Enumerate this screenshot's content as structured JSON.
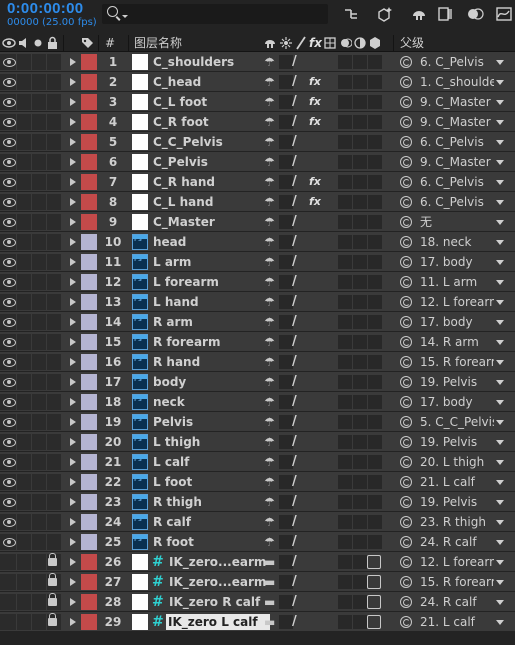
{
  "timecode": "0:00:00:00",
  "fps_readout": "00000 (25.00 fps)",
  "header": {
    "hash": "#",
    "source_name": "图层名称",
    "parent": "父级"
  },
  "layers": [
    {
      "num": "1",
      "name": "C_shoulders",
      "color": "#c44a4a",
      "src": "solid",
      "fx": false,
      "parent": "6. C_Pelvis"
    },
    {
      "num": "2",
      "name": "C_head",
      "color": "#c44a4a",
      "src": "solid",
      "fx": true,
      "parent": "1. C_shoulde"
    },
    {
      "num": "3",
      "name": "C_L foot",
      "color": "#c44a4a",
      "src": "solid",
      "fx": true,
      "parent": "9. C_Master"
    },
    {
      "num": "4",
      "name": "C_R foot",
      "color": "#c44a4a",
      "src": "solid",
      "fx": true,
      "parent": "9. C_Master"
    },
    {
      "num": "5",
      "name": "C_C_Pelvis",
      "color": "#c44a4a",
      "src": "solid",
      "fx": false,
      "parent": "6. C_Pelvis"
    },
    {
      "num": "6",
      "name": "C_Pelvis",
      "color": "#c44a4a",
      "src": "solid",
      "fx": false,
      "parent": "9. C_Master"
    },
    {
      "num": "7",
      "name": "C_R hand",
      "color": "#c44a4a",
      "src": "solid",
      "fx": true,
      "parent": "6. C_Pelvis"
    },
    {
      "num": "8",
      "name": "C_L hand",
      "color": "#c44a4a",
      "src": "solid",
      "fx": true,
      "parent": "6. C_Pelvis"
    },
    {
      "num": "9",
      "name": "C_Master",
      "color": "#c44a4a",
      "src": "solid",
      "fx": false,
      "parent": "无"
    },
    {
      "num": "10",
      "name": "head",
      "color": "#b4b4d2",
      "src": "ps",
      "fx": false,
      "parent": "18. neck"
    },
    {
      "num": "11",
      "name": "L arm",
      "color": "#b4b4d2",
      "src": "ps",
      "fx": false,
      "parent": "17. body"
    },
    {
      "num": "12",
      "name": "L forearm",
      "color": "#b4b4d2",
      "src": "ps",
      "fx": false,
      "parent": "11. L arm"
    },
    {
      "num": "13",
      "name": "L hand",
      "color": "#b4b4d2",
      "src": "ps",
      "fx": false,
      "parent": "12. L forearm"
    },
    {
      "num": "14",
      "name": "R arm",
      "color": "#b4b4d2",
      "src": "ps",
      "fx": false,
      "parent": "17. body"
    },
    {
      "num": "15",
      "name": "R forearm",
      "color": "#b4b4d2",
      "src": "ps",
      "fx": false,
      "parent": "14. R arm"
    },
    {
      "num": "16",
      "name": "R hand",
      "color": "#b4b4d2",
      "src": "ps",
      "fx": false,
      "parent": "15. R forearm"
    },
    {
      "num": "17",
      "name": "body",
      "color": "#b4b4d2",
      "src": "ps",
      "fx": false,
      "parent": "19. Pelvis"
    },
    {
      "num": "18",
      "name": "neck",
      "color": "#b4b4d2",
      "src": "ps",
      "fx": false,
      "parent": "17. body"
    },
    {
      "num": "19",
      "name": "Pelvis",
      "color": "#b4b4d2",
      "src": "ps",
      "fx": false,
      "parent": "5. C_C_Pelvis"
    },
    {
      "num": "20",
      "name": "L thigh",
      "color": "#b4b4d2",
      "src": "ps",
      "fx": false,
      "parent": "19. Pelvis"
    },
    {
      "num": "21",
      "name": "L calf",
      "color": "#b4b4d2",
      "src": "ps",
      "fx": false,
      "parent": "20. L thigh"
    },
    {
      "num": "22",
      "name": "L foot",
      "color": "#b4b4d2",
      "src": "ps",
      "fx": false,
      "parent": "21. L calf"
    },
    {
      "num": "23",
      "name": "R thigh",
      "color": "#b4b4d2",
      "src": "ps",
      "fx": false,
      "parent": "19. Pelvis"
    },
    {
      "num": "24",
      "name": "R calf",
      "color": "#b4b4d2",
      "src": "ps",
      "fx": false,
      "parent": "23. R thigh"
    },
    {
      "num": "25",
      "name": "R foot",
      "color": "#b4b4d2",
      "src": "ps",
      "fx": false,
      "parent": "24. R calf"
    },
    {
      "num": "26",
      "name": "IK_zero...earm",
      "color": "#c44a4a",
      "src": "null",
      "fx": false,
      "parent": "12. L forearm"
    },
    {
      "num": "27",
      "name": "IK_zero...earm",
      "color": "#c44a4a",
      "src": "null",
      "fx": false,
      "parent": "15. R forearm"
    },
    {
      "num": "28",
      "name": "IK_zero R calf",
      "color": "#c44a4a",
      "src": "null",
      "fx": false,
      "parent": "24. R calf"
    },
    {
      "num": "29",
      "name": "IK_zero L calf",
      "color": "#c44a4a",
      "src": "null",
      "fx": false,
      "parent": "21. L calf",
      "selected": true
    }
  ]
}
